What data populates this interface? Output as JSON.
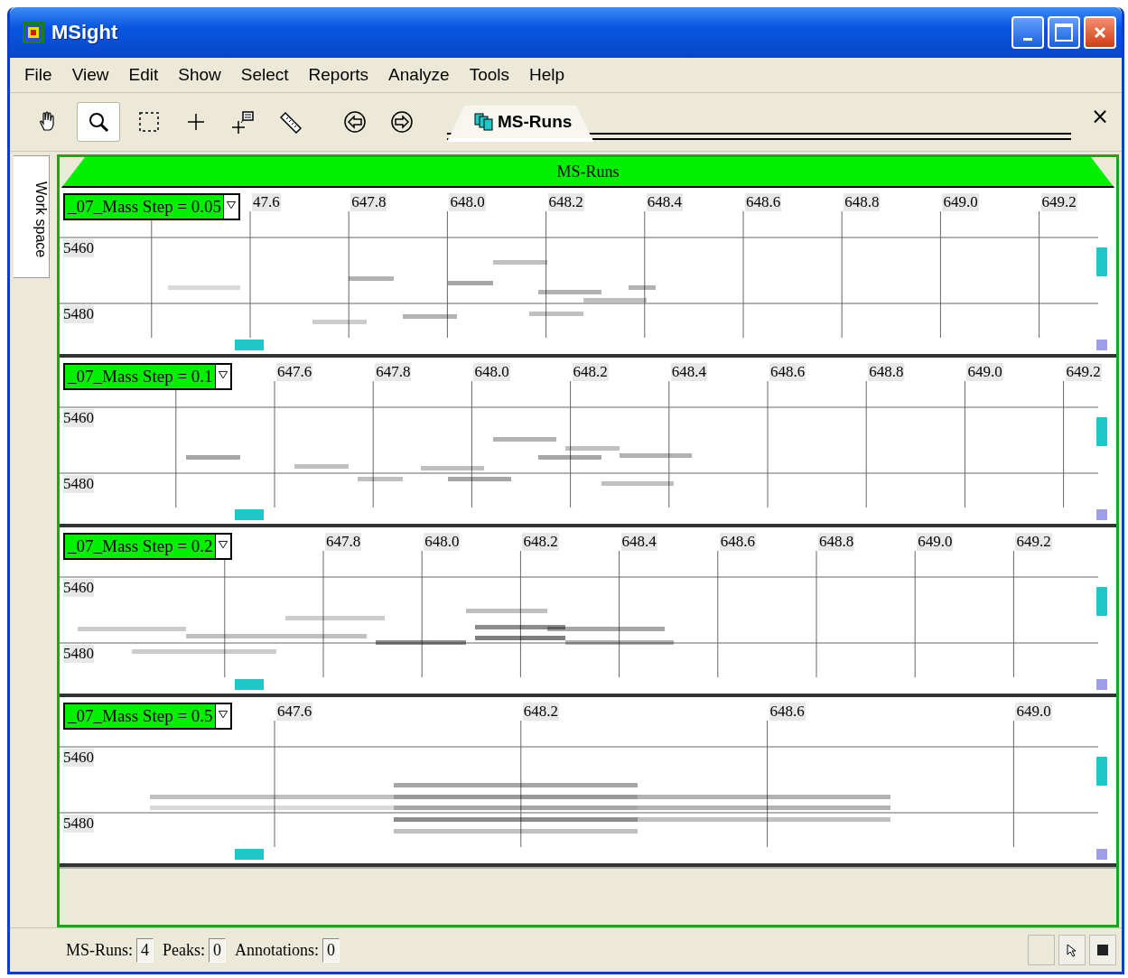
{
  "window": {
    "title": "MSight"
  },
  "menu": [
    {
      "label": "File"
    },
    {
      "label": "View"
    },
    {
      "label": "Edit"
    },
    {
      "label": "Show"
    },
    {
      "label": "Select"
    },
    {
      "label": "Reports"
    },
    {
      "label": "Analyze"
    },
    {
      "label": "Tools"
    },
    {
      "label": "Help"
    }
  ],
  "toolbar": [
    {
      "kind": "hand",
      "selected": false
    },
    {
      "kind": "zoom",
      "selected": true
    },
    {
      "kind": "marquee",
      "selected": false
    },
    {
      "kind": "crosshair",
      "selected": false
    },
    {
      "kind": "annotate",
      "selected": false
    },
    {
      "kind": "ruler",
      "selected": false
    },
    {
      "kind": "back",
      "selected": false
    },
    {
      "kind": "forward",
      "selected": false
    }
  ],
  "tabs": [
    {
      "label": "MS-Runs",
      "selected": true
    }
  ],
  "close": "×",
  "sidebar": {
    "tab": "Work space"
  },
  "panel": {
    "title": "MS-Runs"
  },
  "runs": [
    {
      "label": "_07_Mass Step = 0.05",
      "x_ticks": [
        "47.6",
        "647.8",
        "648.0",
        "648.2",
        "648.4",
        "648.6",
        "648.8",
        "649.0",
        "649.2"
      ],
      "y_labels": [
        "5460",
        "5480"
      ]
    },
    {
      "label": "_07_Mass Step = 0.1",
      "x_ticks": [
        "647.6",
        "647.8",
        "648.0",
        "648.2",
        "648.4",
        "648.6",
        "648.8",
        "649.0",
        "649.2"
      ],
      "y_labels": [
        "5460",
        "5480"
      ]
    },
    {
      "label": "_07_Mass Step = 0.2",
      "x_ticks": [
        "647.8",
        "648.0",
        "648.2",
        "648.4",
        "648.6",
        "648.8",
        "649.0",
        "649.2"
      ],
      "y_labels": [
        "5460",
        "5480"
      ]
    },
    {
      "label": "_07_Mass Step = 0.5",
      "x_ticks": [
        "647.6",
        "648.2",
        "648.6",
        "649.0"
      ],
      "y_labels": [
        "5460",
        "5480"
      ]
    }
  ],
  "status_bar": [
    {
      "label": "MS-Runs:",
      "value": "4"
    },
    {
      "label": "Peaks:",
      "value": "0"
    },
    {
      "label": "Annotations:",
      "value": "0"
    }
  ]
}
